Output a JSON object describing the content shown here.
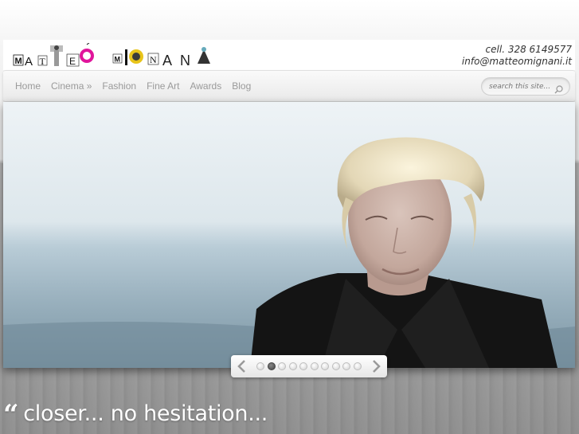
{
  "header": {
    "logo_text": "MATTEO MIGNANI",
    "phone": "cell. 328 6149577",
    "email": "info@matteomignani.it"
  },
  "nav": {
    "items": [
      {
        "label": "Home"
      },
      {
        "label": "Cinema »"
      },
      {
        "label": "Fashion"
      },
      {
        "label": "Fine Art"
      },
      {
        "label": "Awards"
      },
      {
        "label": "Blog"
      }
    ]
  },
  "search": {
    "placeholder": "search this site..."
  },
  "slider": {
    "slide_count": 10,
    "active_index": 1
  },
  "quote": {
    "open_mark": "“",
    "text": "closer... no hesitation..."
  },
  "colors": {
    "nav_text": "#9a9a9a",
    "logo_magenta": "#e0159b",
    "logo_yellow": "#e8c41a"
  }
}
